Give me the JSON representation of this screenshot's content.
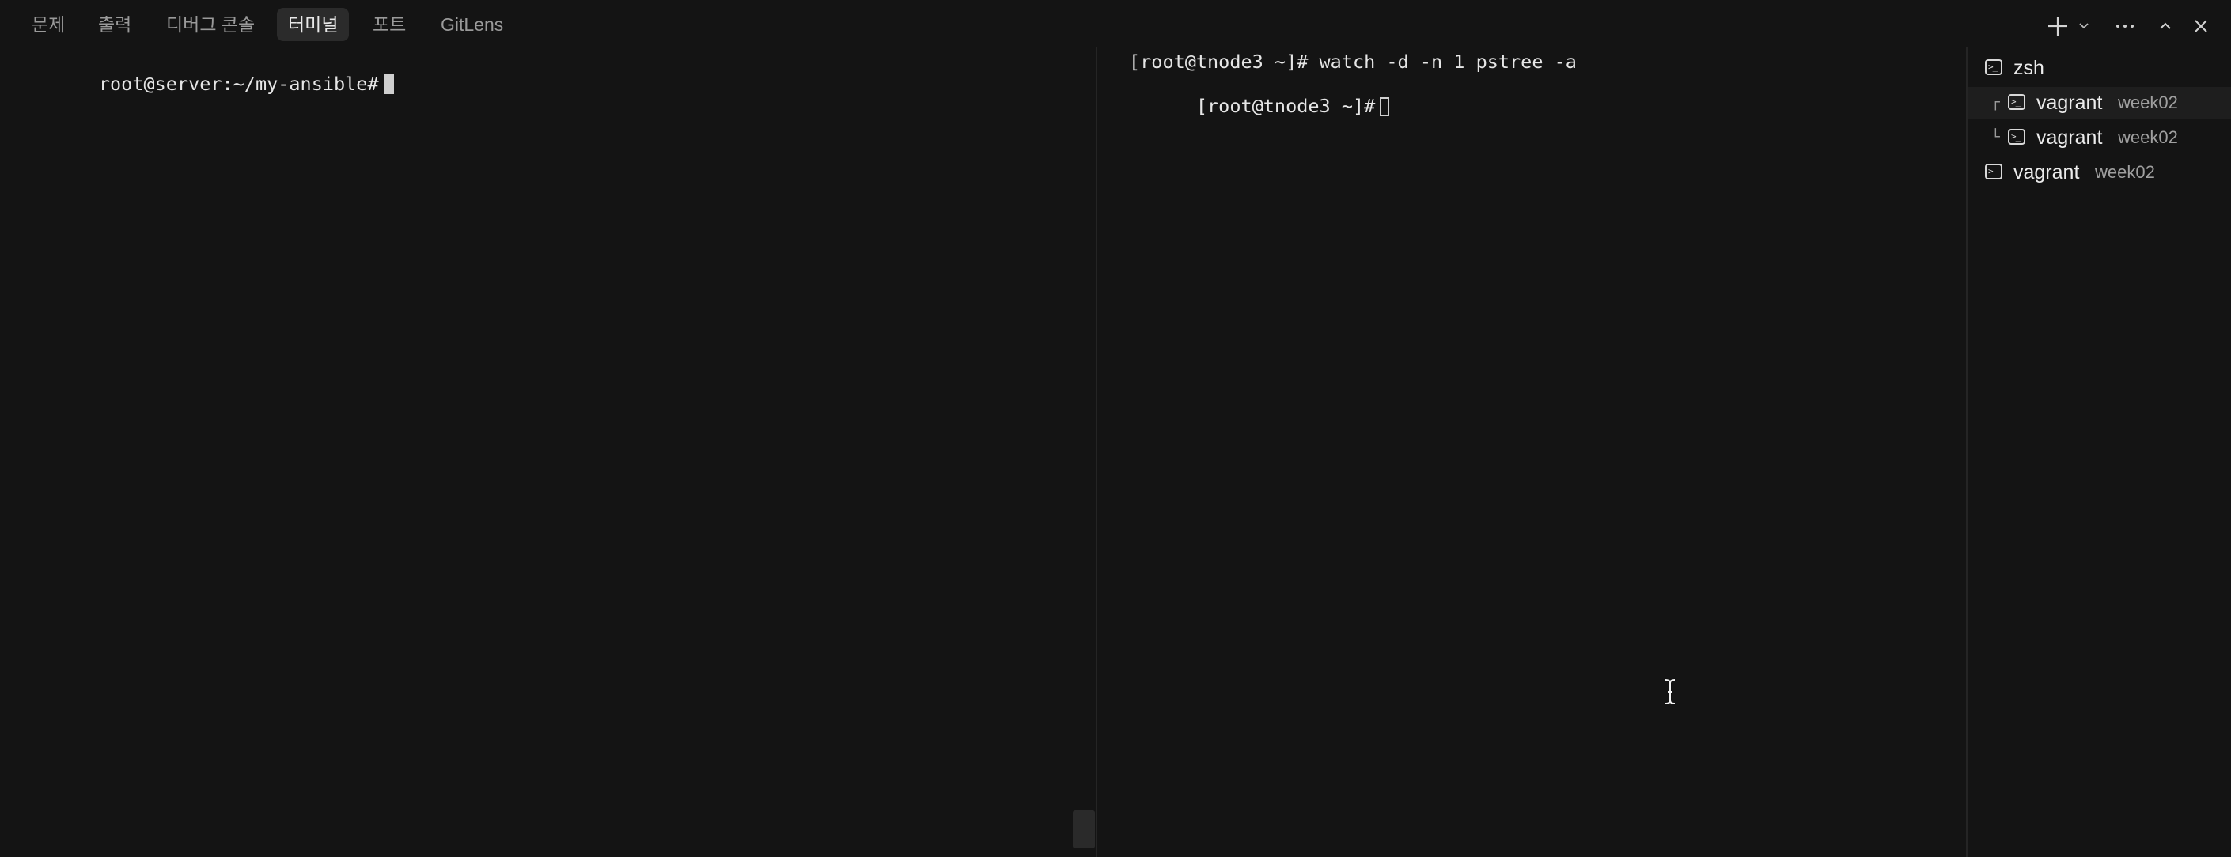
{
  "panel_tabs": [
    {
      "label": "문제",
      "active": false
    },
    {
      "label": "출력",
      "active": false
    },
    {
      "label": "디버그 콘솔",
      "active": false
    },
    {
      "label": "터미널",
      "active": true
    },
    {
      "label": "포트",
      "active": false
    },
    {
      "label": "GitLens",
      "active": false
    }
  ],
  "toolbar": {
    "new_terminal_icon": "plus-icon",
    "new_terminal_dropdown_icon": "chevron-down-icon",
    "more_icon": "ellipsis-icon",
    "maximize_icon": "chevron-up-icon",
    "close_icon": "close-icon"
  },
  "left_terminal": {
    "prompt": "root@server:~/my-ansible#"
  },
  "right_terminal": {
    "line1": "[root@tnode3 ~]# watch -d -n 1 pstree -a",
    "line2": "[root@tnode3 ~]#"
  },
  "terminal_list": [
    {
      "name": "zsh",
      "desc": "",
      "tree": ""
    },
    {
      "name": "vagrant",
      "desc": "week02",
      "tree": "┌"
    },
    {
      "name": "vagrant",
      "desc": "week02",
      "tree": "└"
    },
    {
      "name": "vagrant",
      "desc": "week02",
      "tree": ""
    }
  ],
  "colors": {
    "background": "#141414",
    "active_tab_bg": "#2b2b2b",
    "text": "#e6e6e6",
    "muted": "#9a9a9a"
  }
}
